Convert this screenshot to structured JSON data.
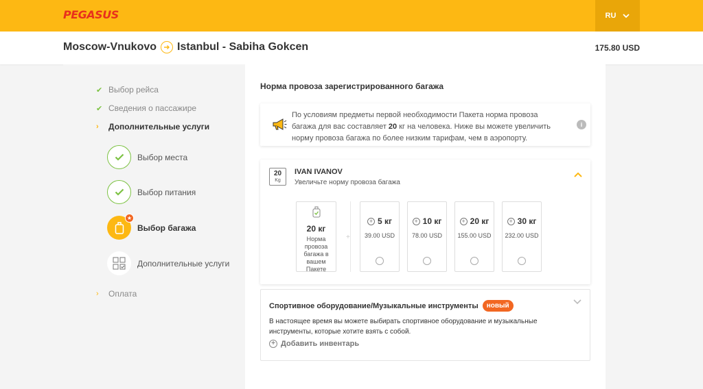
{
  "header": {
    "logo": "PEGASUS",
    "lang": "RU"
  },
  "route": {
    "from": "Moscow-Vnukovo",
    "to": "Istanbul - Sabiha Gokcen",
    "price": "175.80 USD"
  },
  "sidebar": {
    "steps": [
      {
        "label": "Выбор рейса",
        "state": "done"
      },
      {
        "label": "Сведения о пассажире",
        "state": "done"
      },
      {
        "label": "Дополнительные услуги",
        "state": "current"
      },
      {
        "label": "Оплата",
        "state": "future"
      }
    ],
    "substeps": [
      {
        "label": "Выбор места",
        "state": "done"
      },
      {
        "label": "Выбор питания",
        "state": "done"
      },
      {
        "label": "Выбор багажа",
        "state": "active"
      },
      {
        "label": "Дополнительные услуги",
        "state": "pending"
      }
    ]
  },
  "main": {
    "title": "Норма провоза зарегистрированного багажа",
    "info": {
      "part1": "По условиям предметы первой необходимости Пакета норма провоза багажа для вас составляет ",
      "bold": "20",
      "part2": " кг на человека. Ниже вы можете увеличить норму провоза багажа по более низким тарифам, чем в аэропорту."
    },
    "passenger": {
      "allowance_num": "20",
      "allowance_unit": "Kg",
      "name": "IVAN IVANOV",
      "subtitle": "Увеличьте норму провоза багажа",
      "included_weight": "20 кг",
      "included_desc": "Норма провоза багажа в вашем Пакете",
      "plus": "+",
      "options": [
        {
          "weight": "5 кг",
          "price": "39.00 USD"
        },
        {
          "weight": "10 кг",
          "price": "78.00 USD"
        },
        {
          "weight": "20 кг",
          "price": "155.00 USD"
        },
        {
          "weight": "30 кг",
          "price": "232.00 USD"
        }
      ]
    },
    "sport": {
      "title": "Спортивное оборудование/Музыкальные инструменты",
      "badge": "новый",
      "text": "В настоящее время вы можете выбирать спортивное оборудование и музыкальные инструменты, которые хотите взять с собой.",
      "add_label": "Добавить инвентарь"
    }
  },
  "colors": {
    "brand_yellow": "#fdb813",
    "accent_orange": "#f26722",
    "done_green": "#7cc242",
    "logo_red": "#e8301c"
  }
}
